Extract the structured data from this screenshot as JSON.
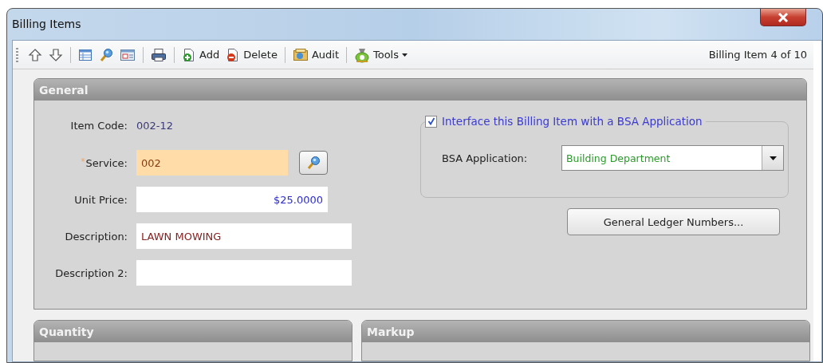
{
  "window": {
    "title": "Billing Items"
  },
  "toolbar": {
    "items": [
      {
        "kind": "up"
      },
      {
        "kind": "down"
      },
      {
        "kind": "separator"
      },
      {
        "kind": "grid"
      },
      {
        "kind": "search"
      },
      {
        "kind": "form"
      },
      {
        "kind": "separator"
      },
      {
        "kind": "print"
      },
      {
        "kind": "separator"
      },
      {
        "kind": "add",
        "label": "Add"
      },
      {
        "kind": "delete",
        "label": "Delete"
      },
      {
        "kind": "separator"
      },
      {
        "kind": "audit",
        "label": "Audit"
      },
      {
        "kind": "separator"
      },
      {
        "kind": "tools",
        "label": "Tools",
        "dropdown": true
      }
    ],
    "record_counter": "Billing Item 4 of 10"
  },
  "general": {
    "title": "General",
    "fields": [
      {
        "kind": "readonly",
        "label": "Item Code:",
        "value": "002-12"
      },
      {
        "kind": "lookup",
        "label": "Service:",
        "required_mark": "*",
        "value": "002"
      },
      {
        "kind": "money",
        "label": "Unit Price:",
        "value": "$25.0000"
      },
      {
        "kind": "text",
        "label": "Description:",
        "value": "LAWN MOWING"
      },
      {
        "kind": "text2",
        "label": "Description 2:"
      }
    ],
    "interface": {
      "label": "Interface this Billing Item with a BSA Application",
      "checked": true,
      "application": {
        "label": "BSA Application:",
        "value": "Building Department"
      }
    },
    "ledger_button": "General Ledger Numbers..."
  },
  "bottom_panels": [
    {
      "title": "Quantity"
    },
    {
      "title": "Markup"
    }
  ]
}
